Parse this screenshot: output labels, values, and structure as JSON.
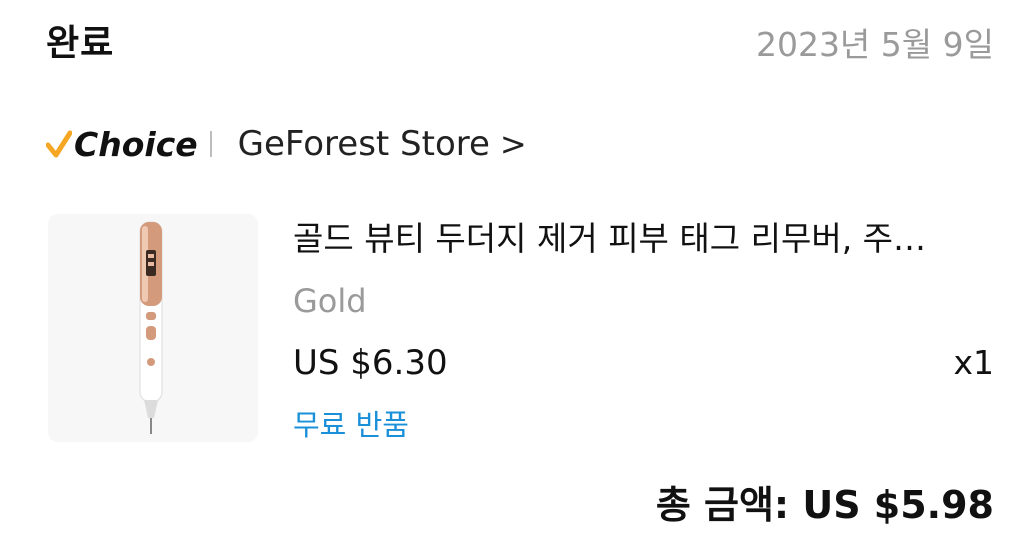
{
  "order": {
    "status": "완료",
    "date": "2023년 5월 9일"
  },
  "store": {
    "badge": "Choice",
    "badge_icon": "check-icon",
    "accent": "#F5A623",
    "name": "GeForest Store",
    "chevron": ">"
  },
  "item": {
    "image": "beauty-pen-image",
    "title": "골드 뷰티 두더지 제거 피부 태그 리무버, 주…",
    "variant": "Gold",
    "price": "US $6.30",
    "quantity": "x1",
    "return_policy": "무료 반품",
    "return_color": "#1A90D8"
  },
  "summary": {
    "total": "총 금액: US $5.98"
  }
}
